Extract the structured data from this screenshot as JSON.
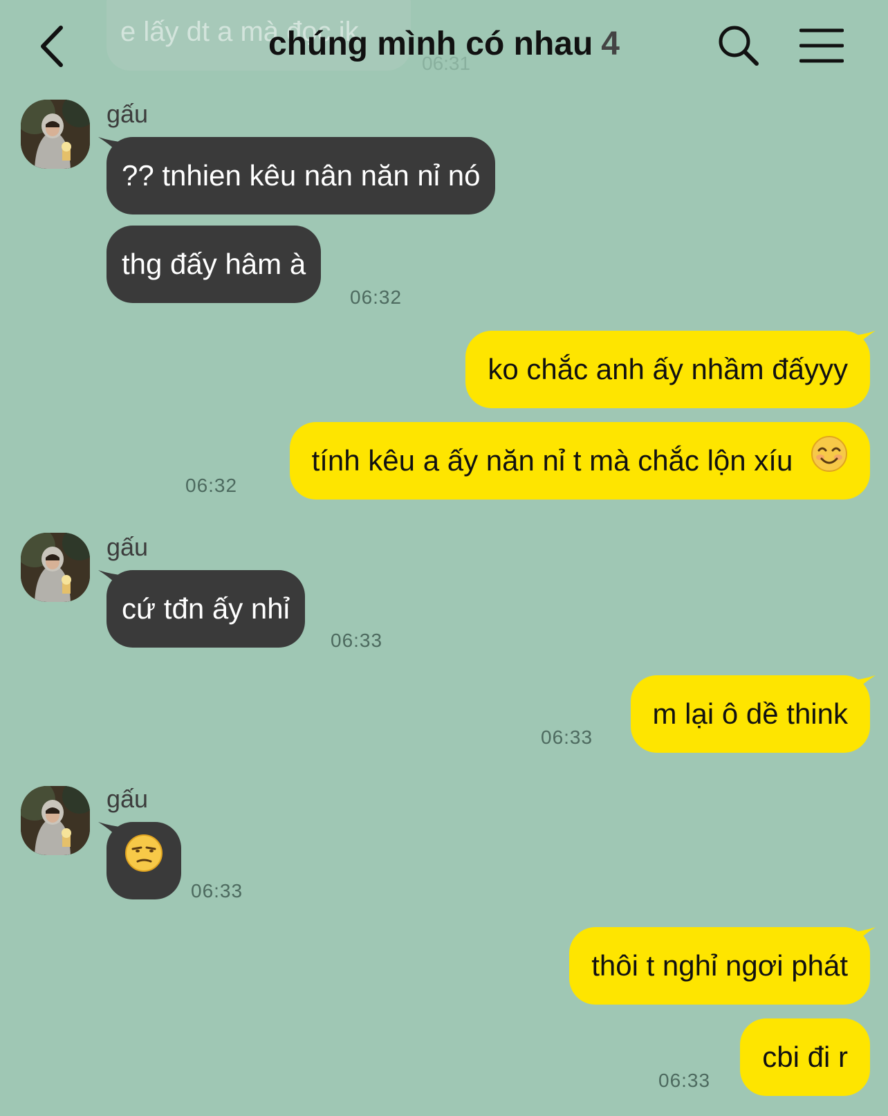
{
  "header": {
    "title": "chúng mình có nhau",
    "member_count": "4",
    "back_icon": "chevron-left-icon",
    "search_icon": "search-icon",
    "menu_icon": "hamburger-menu-icon"
  },
  "faded_message": {
    "text": "e lấy dt a mà đọc ik",
    "time": "06:31"
  },
  "colors": {
    "background": "#9fc7b4",
    "incoming_bubble": "#3a3a3a",
    "outgoing_bubble": "#fee500"
  },
  "messages": [
    {
      "sender": "gấu",
      "text": "?? tnhien kêu nân năn nỉ nó"
    },
    {
      "text": "thg đấy hâm à",
      "time": "06:32"
    },
    {
      "text": "ko chắc anh ấy nhầm đấyyy"
    },
    {
      "text": "tính kêu a ấy năn nỉ t mà chắc lộn xíu",
      "emoji": "smiling-face-icon",
      "time": "06:32"
    },
    {
      "sender": "gấu",
      "text": "cứ tđn ấy nhỉ",
      "time": "06:33"
    },
    {
      "text": "m lại ô dề think",
      "time": "06:33"
    },
    {
      "sender": "gấu",
      "emoji": "unamused-face-icon",
      "time": "06:33"
    },
    {
      "text": "thôi t nghỉ ngơi phát"
    },
    {
      "text": "cbi đi r",
      "time": "06:33"
    }
  ]
}
